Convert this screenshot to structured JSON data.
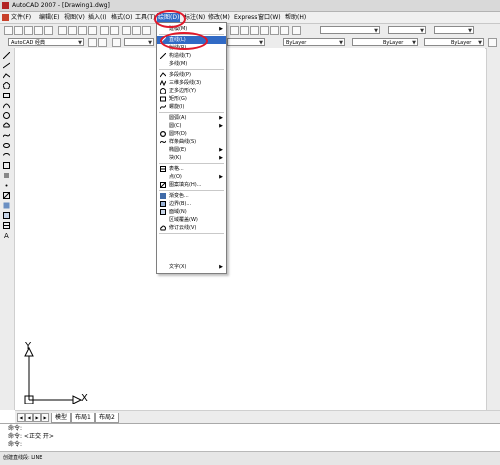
{
  "window": {
    "title": "AutoCAD 2007 - [Drawing1.dwg]"
  },
  "menubar": {
    "items": [
      {
        "label": "文件(F)"
      },
      {
        "label": "编辑(E)"
      },
      {
        "label": "视图(V)"
      },
      {
        "label": "插入(I)"
      },
      {
        "label": "格式(O)"
      },
      {
        "label": "工具(T)"
      },
      {
        "label": "绘图(D)"
      },
      {
        "label": "标注(N)"
      },
      {
        "label": "修改(M)"
      },
      {
        "label": "Express"
      },
      {
        "label": "窗口(W)"
      },
      {
        "label": "帮助(H)"
      }
    ]
  },
  "toolbar2": {
    "workspace": "AutoCAD 经典",
    "layer_color": "ByLayer",
    "linetype": "ByLayer",
    "lineweight": "ByLayer"
  },
  "draw_menu": {
    "items": [
      {
        "label": "建模(M)",
        "submenu": true,
        "icon": "none"
      },
      {
        "label": "直线(L)",
        "icon": "line-icon",
        "highlighted": true
      },
      {
        "label": "射线(R)",
        "icon": "none"
      },
      {
        "label": "构造线(T)",
        "icon": "construction-line-icon"
      },
      {
        "label": "多线(M)",
        "icon": "none"
      },
      {
        "label": "多段线(P)",
        "icon": "polyline-icon"
      },
      {
        "label": "三维多段线(3)",
        "icon": "3d-polyline-icon"
      },
      {
        "label": "正多边形(Y)",
        "icon": "polygon-icon"
      },
      {
        "label": "矩形(G)",
        "icon": "rectangle-icon"
      },
      {
        "label": "螺旋(I)",
        "icon": "helix-icon"
      },
      {
        "label": "圆弧(A)",
        "submenu": true,
        "icon": "none"
      },
      {
        "label": "圆(C)",
        "submenu": true,
        "icon": "none"
      },
      {
        "label": "圆环(D)",
        "icon": "donut-icon"
      },
      {
        "label": "样条曲线(S)",
        "icon": "spline-icon"
      },
      {
        "label": "椭圆(E)",
        "submenu": true,
        "icon": "none"
      },
      {
        "label": "块(K)",
        "submenu": true,
        "icon": "none"
      },
      {
        "label": "表格...",
        "icon": "table-icon"
      },
      {
        "label": "点(O)",
        "submenu": true,
        "icon": "none"
      },
      {
        "label": "图案填充(H)...",
        "icon": "hatch-icon"
      },
      {
        "label": "渐变色...",
        "icon": "gradient-icon"
      },
      {
        "label": "边界(B)...",
        "icon": "boundary-icon"
      },
      {
        "label": "面域(N)",
        "icon": "region-icon"
      },
      {
        "label": "区域覆盖(W)",
        "icon": "none"
      },
      {
        "label": "修订云线(V)",
        "icon": "revcloud-icon"
      },
      {
        "label": "文字(X)",
        "submenu": true,
        "icon": "none"
      }
    ]
  },
  "ucs": {
    "x_label": "X",
    "y_label": "Y"
  },
  "tabs": [
    {
      "label": "模型"
    },
    {
      "label": "布局1"
    },
    {
      "label": "布局2"
    }
  ],
  "command": {
    "line1": "命令:",
    "line2": "命令:  <正交 开>",
    "line3": "命令:"
  },
  "status": {
    "text": "创建直线段:  LINE"
  },
  "colors": {
    "highlight": "#316ac5",
    "annotation_red": "#e0182a"
  }
}
